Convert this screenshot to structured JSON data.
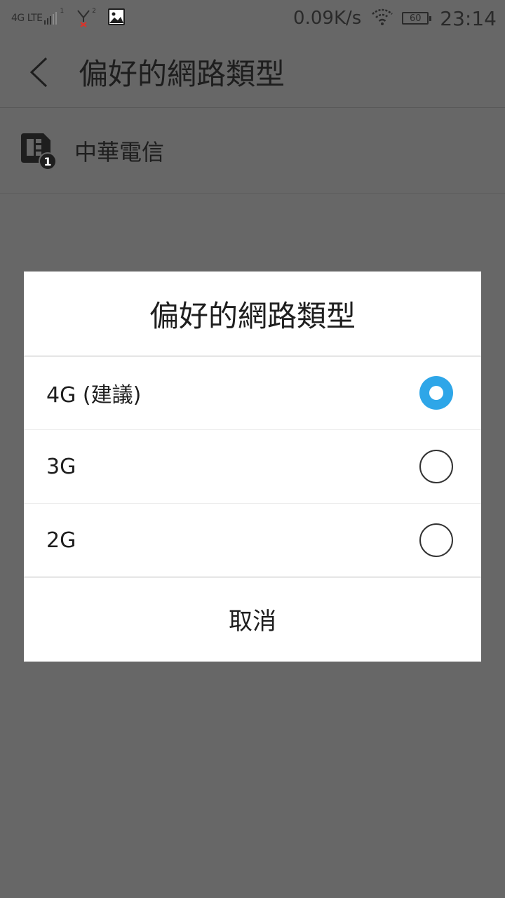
{
  "status_bar": {
    "network_label": "4G LTE",
    "sim1_badge": "1",
    "sim2_badge": "2",
    "speed": "0.09K/s",
    "battery": "60",
    "time": "23:14",
    "icons": [
      "signal-icon",
      "sim-no-signal-icon",
      "picture-icon",
      "wifi-icon",
      "battery-icon"
    ]
  },
  "header": {
    "title": "偏好的網路類型",
    "back_icon": "back-arrow-icon"
  },
  "carrier": {
    "name": "中華電信",
    "sim_badge": "1"
  },
  "dialog": {
    "title": "偏好的網路類型",
    "options": [
      {
        "label": "4G (建議)",
        "selected": true
      },
      {
        "label": "3G",
        "selected": false
      },
      {
        "label": "2G",
        "selected": false
      }
    ],
    "cancel_label": "取消",
    "accent_color": "#2ea6e8"
  }
}
